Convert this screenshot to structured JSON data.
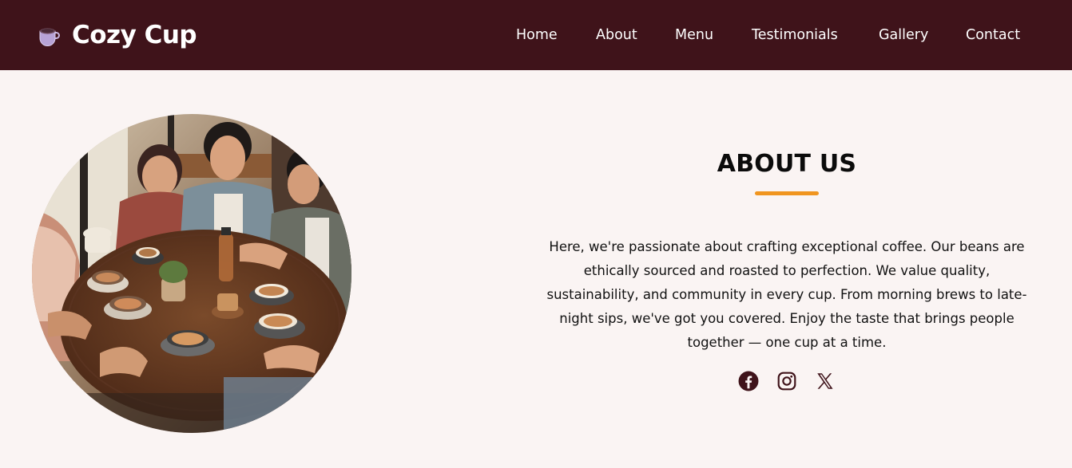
{
  "brand": {
    "name": "Cozy Cup",
    "icon": "coffee-cup-icon"
  },
  "nav": {
    "items": [
      {
        "label": "Home"
      },
      {
        "label": "About"
      },
      {
        "label": "Menu"
      },
      {
        "label": "Testimonials"
      },
      {
        "label": "Gallery"
      },
      {
        "label": "Contact"
      }
    ]
  },
  "about": {
    "image": "friends-drinking-coffee-photo",
    "title": "ABOUT US",
    "text": "Here, we're passionate about crafting exceptional coffee. Our beans are ethically sourced and roasted to perfection. We value quality, sustainability, and community in every cup. From morning brews to late-night sips, we've got you covered. Enjoy the taste that brings people together — one cup at a time.",
    "socials": [
      {
        "icon": "facebook-icon"
      },
      {
        "icon": "instagram-icon"
      },
      {
        "icon": "x-twitter-icon"
      }
    ]
  },
  "colors": {
    "header_bg": "#3f131a",
    "page_bg": "#faf4f3",
    "accent": "#f0951f",
    "social_icon": "#3f131a"
  }
}
